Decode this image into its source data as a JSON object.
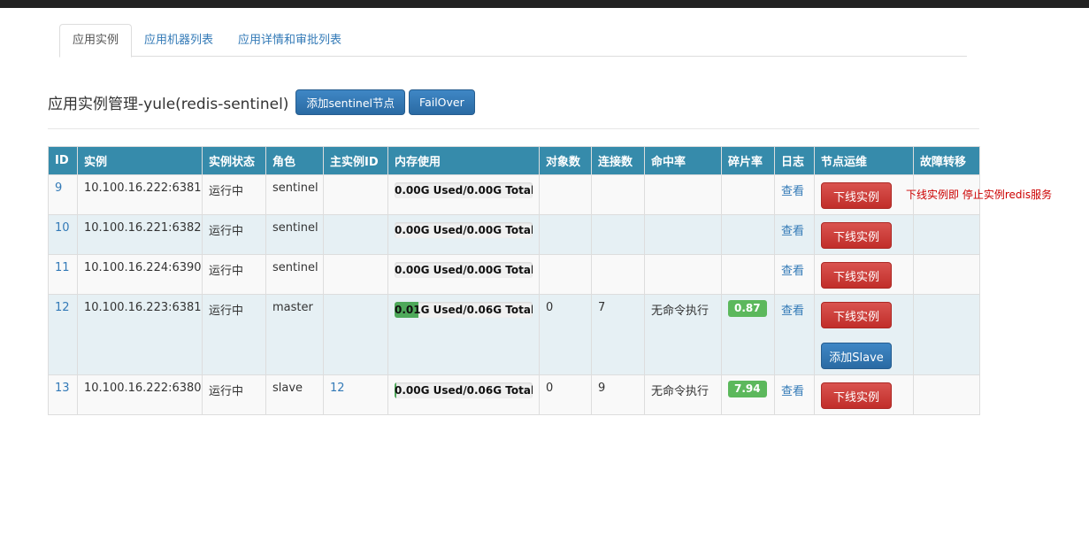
{
  "tabs": [
    {
      "label": "应用实例",
      "active": true
    },
    {
      "label": "应用机器列表",
      "active": false
    },
    {
      "label": "应用详情和审批列表",
      "active": false
    }
  ],
  "header": {
    "title": "应用实例管理-yule(redis-sentinel)",
    "add_sentinel_label": "添加sentinel节点",
    "failover_label": "FailOver"
  },
  "table": {
    "columns": [
      "ID",
      "实例",
      "实例状态",
      "角色",
      "主实例ID",
      "内存使用",
      "对象数",
      "连接数",
      "命中率",
      "碎片率",
      "日志",
      "节点运维",
      "故障转移"
    ],
    "rows": [
      {
        "id": "9",
        "instance": "10.100.16.222:6381",
        "status": "运行中",
        "role": "sentinel",
        "master_id": "",
        "memory": "0.00G  Used/0.00G  Total",
        "mem_fraction": 0,
        "objects": "",
        "connections": "",
        "hit_rate": "",
        "frag": "",
        "log": "查看",
        "offline_label": "下线实例",
        "add_slave_label": ""
      },
      {
        "id": "10",
        "instance": "10.100.16.221:6382",
        "status": "运行中",
        "role": "sentinel",
        "master_id": "",
        "memory": "0.00G  Used/0.00G  Total",
        "mem_fraction": 0,
        "objects": "",
        "connections": "",
        "hit_rate": "",
        "frag": "",
        "log": "查看",
        "offline_label": "下线实例",
        "add_slave_label": ""
      },
      {
        "id": "11",
        "instance": "10.100.16.224:6390",
        "status": "运行中",
        "role": "sentinel",
        "master_id": "",
        "memory": "0.00G  Used/0.00G  Total",
        "mem_fraction": 0,
        "objects": "",
        "connections": "",
        "hit_rate": "",
        "frag": "",
        "log": "查看",
        "offline_label": "下线实例",
        "add_slave_label": ""
      },
      {
        "id": "12",
        "instance": "10.100.16.223:6381",
        "status": "运行中",
        "role": "master",
        "master_id": "",
        "memory": "0.01G  Used/0.06G  Total",
        "mem_fraction": 0.17,
        "objects": "0",
        "connections": "7",
        "hit_rate": "无命令执行",
        "frag": "0.87",
        "log": "查看",
        "offline_label": "下线实例",
        "add_slave_label": "添加Slave"
      },
      {
        "id": "13",
        "instance": "10.100.16.222:6380",
        "status": "运行中",
        "role": "slave",
        "master_id": "12",
        "memory": "0.00G  Used/0.06G  Total",
        "mem_fraction": 0.01,
        "objects": "0",
        "connections": "9",
        "hit_rate": "无命令执行",
        "frag": "7.94",
        "log": "查看",
        "offline_label": "下线实例",
        "add_slave_label": ""
      }
    ]
  },
  "hint_text": "下线实例即 停止实例redis服务",
  "colors": {
    "header_bg": "#368bab",
    "danger": "#d9534f",
    "primary": "#337ab7",
    "success": "#5cb85c"
  }
}
